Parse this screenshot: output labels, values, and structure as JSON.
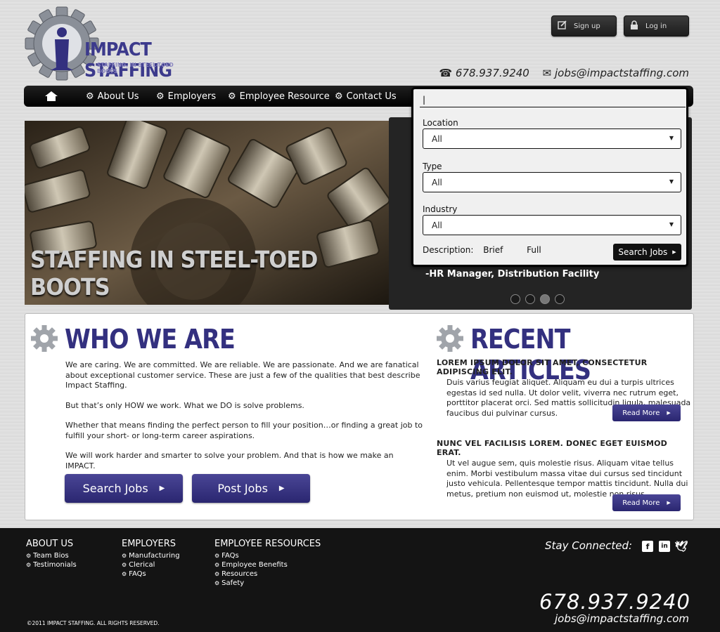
{
  "brand": {
    "name": "IMPACT STAFFING",
    "tagline": "STAFFING, IN STEEL-TOED BOOTS",
    "color": "#33307f"
  },
  "header": {
    "signup_label": "Sign up",
    "login_label": "Log in",
    "phone": "678.937.9240",
    "email": "jobs@impactstaffing.com"
  },
  "nav": {
    "items": [
      {
        "label": "About Us"
      },
      {
        "label": "Employers"
      },
      {
        "label": "Employee Resource"
      },
      {
        "label": "Contact Us"
      }
    ]
  },
  "hero": {
    "caption": "STAFFING IN STEEL-TOED BOOTS"
  },
  "job_panel": {
    "featured_job": "-HR Manager, Distribution Facility"
  },
  "search": {
    "keyword_value": "|",
    "location_label": "Location",
    "location_value": "All",
    "type_label": "Type",
    "type_value": "All",
    "industry_label": "Industry",
    "industry_value": "All",
    "description_label": "Description:",
    "desc_brief": "Brief",
    "desc_full": "Full",
    "button_label": "Search Jobs"
  },
  "who": {
    "title": "WHO WE ARE",
    "p1": "We are caring. We are committed. We are reliable. We are passionate. And we are fanatical about exceptional customer service. These are just a few of the qualities that best describe Impact Staffing.",
    "p2": "But that’s only HOW we work. What we DO is solve problems.",
    "p3": "Whether that means finding the perfect person to fill your position…or finding a great job to fulfill your short- or long-term career aspirations.",
    "p4": "We will work harder and smarter to solve your problem. And that is how we make an IMPACT.",
    "search_jobs_label": "Search Jobs",
    "post_jobs_label": "Post Jobs"
  },
  "articles": {
    "title": "RECENT ARTICLES",
    "items": [
      {
        "heading": "LOREM IPSUM DOLOR SIT AMET, CONSECTETUR ADIPISCING ELIT.",
        "body": "Duis varius feugiat aliquet. Aliquam eu dui a turpis ultrices egestas id sed nulla. Ut dolor velit, viverra nec rutrum eget, porttitor placerat orci. Sed mattis sollicitudin ligula, malesuada faucibus dui pulvinar cursus.",
        "read_more": "Read More"
      },
      {
        "heading": "NUNC VEL FACILISIS LOREM. DONEC EGET EUISMOD ERAT.",
        "body": "Ut vel augue sem, quis molestie risus. Aliquam vitae tellus enim. Morbi vestibulum massa vitae dui cursus sed tincidunt justo vehicula. Pellentesque tempor mattis tincidunt. Nulla dui metus, pretium non euismod ut, molestie non risus.",
        "read_more": "Read More"
      }
    ]
  },
  "footer": {
    "about": {
      "heading": "ABOUT US",
      "links": [
        "Team Bios",
        "Testimonials"
      ]
    },
    "employers": {
      "heading": "EMPLOYERS",
      "links": [
        "Manufacturing",
        "Clerical",
        "FAQs"
      ]
    },
    "employee": {
      "heading": "EMPLOYEE RESOURCES",
      "links": [
        "FAQs",
        "Employee Benefits",
        "Resources",
        "Safety"
      ]
    },
    "stay_connected": "Stay Connected:",
    "social": {
      "facebook": "f",
      "linkedin": "in"
    },
    "phone": "678.937.9240",
    "email": "jobs@impactstaffing.com",
    "copyright": "©2011 IMPACT STAFFING. ALL RIGHTS RESERVED."
  }
}
